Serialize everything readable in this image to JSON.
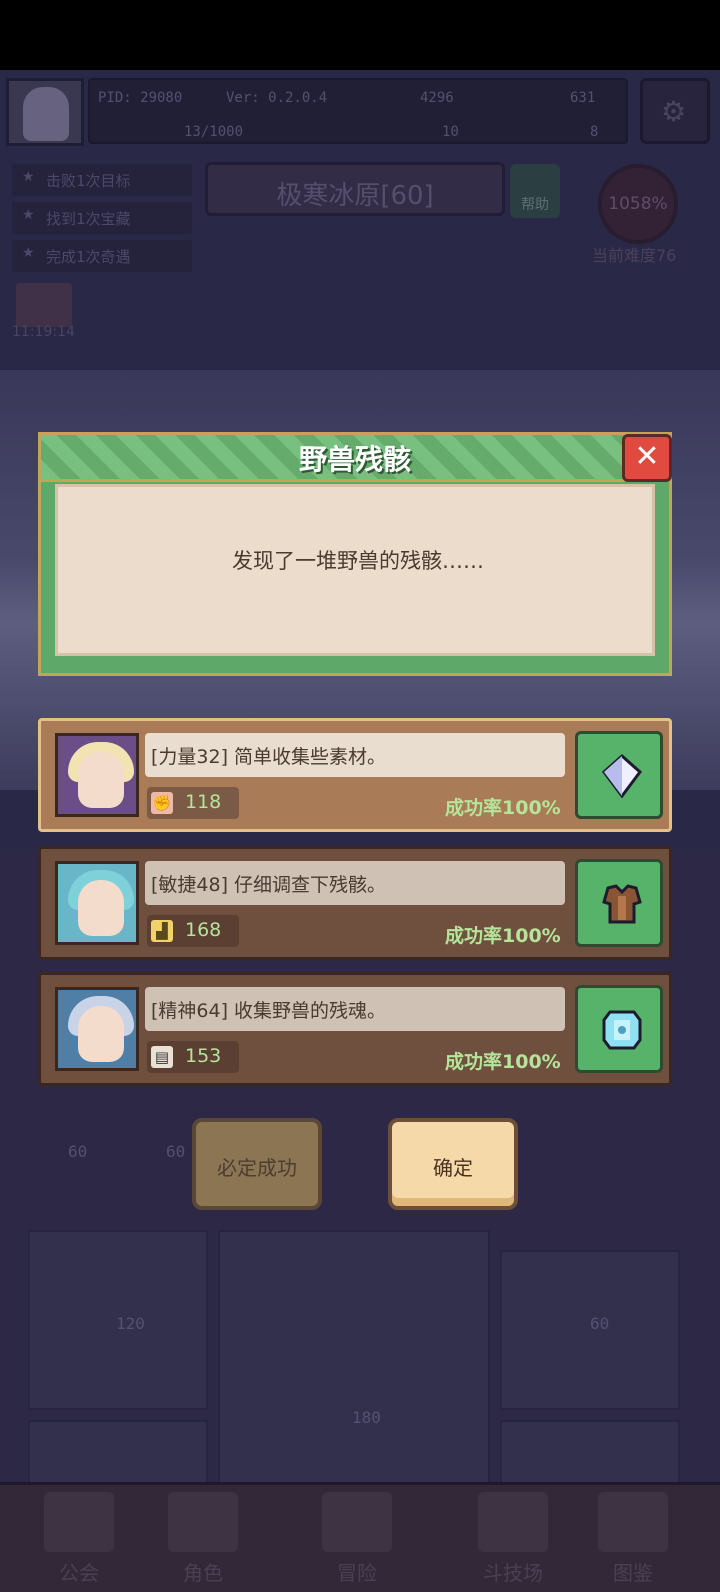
{
  "hud": {
    "pid": "PID: 29080",
    "version": "Ver: 0.2.0.4",
    "currency_1": "4296",
    "currency_2": "631",
    "energy": "13/1000",
    "clover": "10",
    "keys": "8"
  },
  "quests": [
    "击败1次目标",
    "找到1次宝藏",
    "完成1次奇遇"
  ],
  "zone": {
    "name": "极寒冰原[60]",
    "help_label": "帮助",
    "percent": "1058%",
    "difficulty": "当前难度76",
    "timer": "11:19:14"
  },
  "dialog": {
    "title": "野兽残骸",
    "message": "发现了一堆野兽的残骸……",
    "close_icon": "close-icon"
  },
  "options": [
    {
      "text": "[力量32] 简单收集些素材。",
      "cost": "118",
      "cost_icon": "fist-icon",
      "rate": "成功率100%",
      "reward_icon": "crystal-icon"
    },
    {
      "text": "[敏捷48] 仔细调查下残骸。",
      "cost": "168",
      "cost_icon": "boot-icon",
      "rate": "成功率100%",
      "reward_icon": "leather-armor-icon"
    },
    {
      "text": "[精神64] 收集野兽的残魂。",
      "cost": "153",
      "cost_icon": "book-icon",
      "rate": "成功率100%",
      "reward_icon": "soul-gem-icon"
    }
  ],
  "buttons": {
    "guaranteed": "必定成功",
    "confirm": "确定"
  },
  "background_values": [
    "60",
    "60",
    "120",
    "60",
    "180"
  ],
  "nav": [
    "公会",
    "角色",
    "冒险",
    "斗技场",
    "图鉴"
  ],
  "colors": {
    "dialog_green": "#69b272",
    "success_text": "#b5e49a",
    "close_red": "#e04a3f"
  }
}
